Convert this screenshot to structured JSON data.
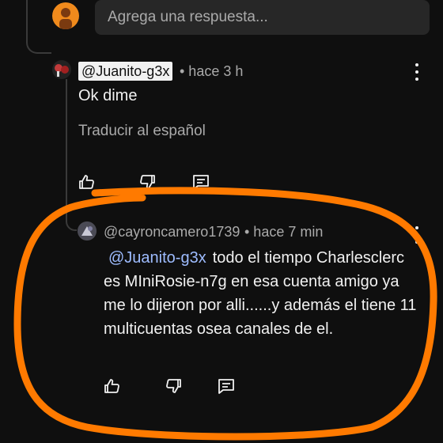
{
  "reply_input": {
    "placeholder": "Agrega una respuesta..."
  },
  "comment1": {
    "author": "@Juanito-g3x",
    "time": "• hace 3 h",
    "text": "Ok dime",
    "translate": "Traducir al español"
  },
  "comment2": {
    "author": "@cayroncamero1739",
    "time": "• hace 7 min",
    "mention": "@Juanito-g3x",
    "text": "todo el tiempo Charlesclerc es MIniRosie-n7g en esa cuenta amigo ya me lo dijeron por alli......y además el tiene 11 multicuentas osea canales de el."
  },
  "icons": [
    "thumbs-up-icon",
    "thumbs-down-icon",
    "reply-icon",
    "more-vert-icon"
  ],
  "colors": {
    "background": "#0f0f0f",
    "text": "#f1f1f1",
    "secondary_text": "#aaaaaa",
    "mention": "#9ebcff",
    "annotation": "#ff7a00"
  }
}
